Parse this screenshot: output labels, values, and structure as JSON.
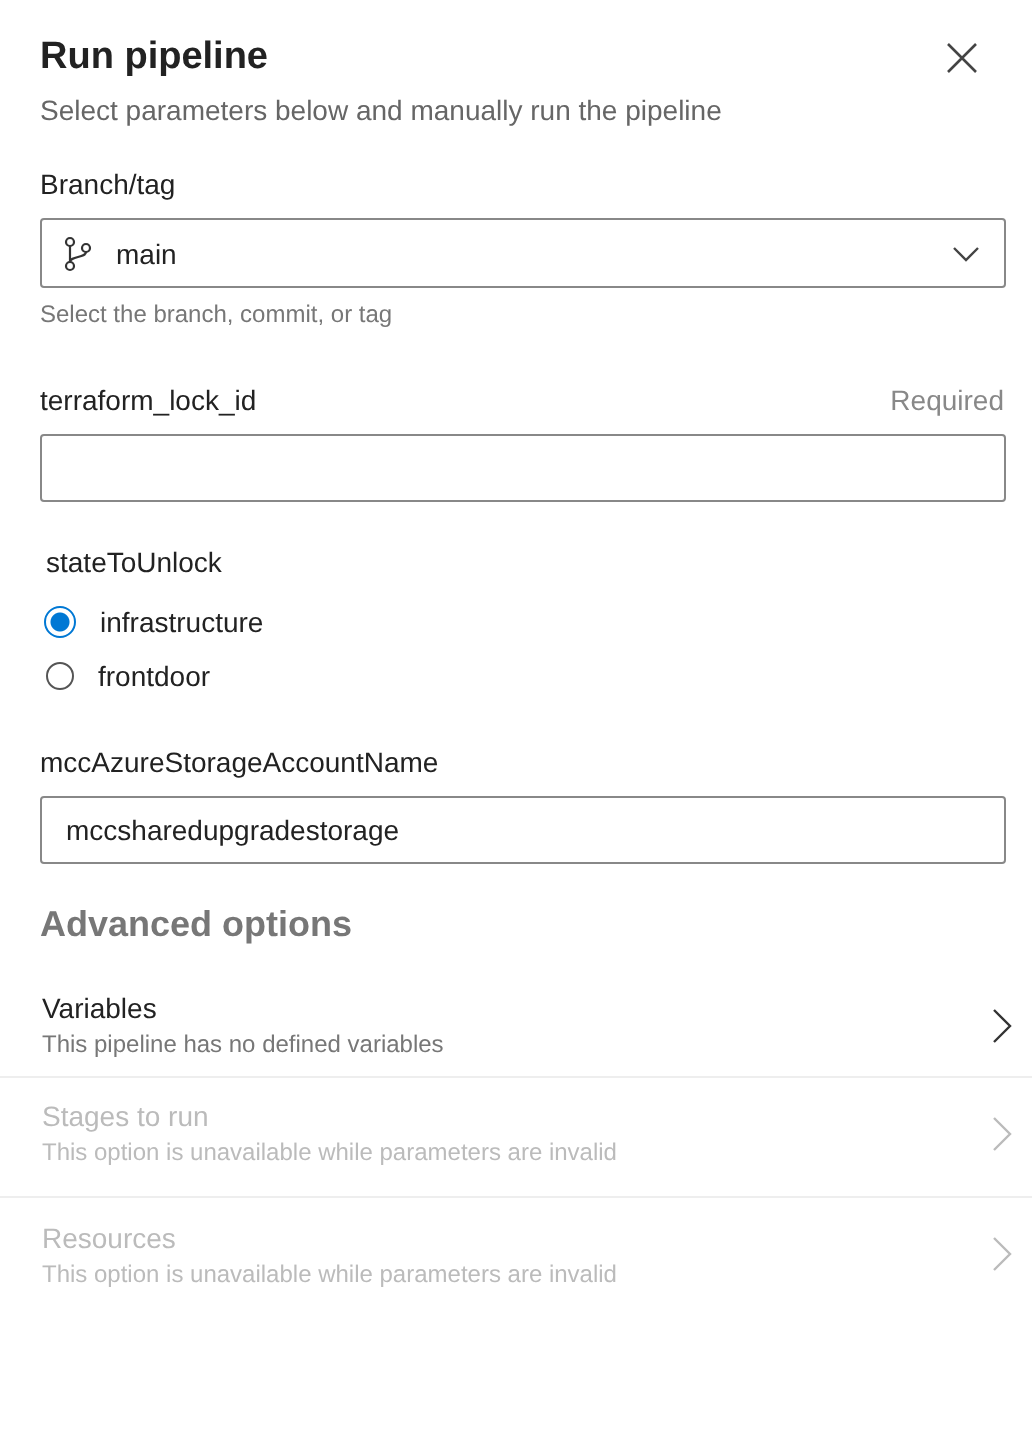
{
  "dialog": {
    "title": "Run pipeline",
    "subtitle": "Select parameters below and manually run the pipeline"
  },
  "branch": {
    "label": "Branch/tag",
    "value": "main",
    "hint": "Select the branch, commit, or tag"
  },
  "parameters": [
    {
      "kind": "text",
      "label": "terraform_lock_id",
      "note": "Required"
    },
    {
      "kind": "radio",
      "label": "stateToUnlock",
      "options": [
        {
          "label": "infrastructure",
          "selected": true
        },
        {
          "label": "frontdoor",
          "selected": false
        }
      ]
    },
    {
      "kind": "text",
      "label": "mccAzureStorageAccountName",
      "value": "mccsharedupgradestorage"
    }
  ],
  "advanced": {
    "title": "Advanced options",
    "items": [
      {
        "title": "Variables",
        "description": "This pipeline has no defined variables",
        "disabled": false
      },
      {
        "title": "Stages to run",
        "description": "This option is unavailable while parameters are invalid",
        "disabled": true
      },
      {
        "title": "Resources",
        "description": "This option is unavailable while parameters are invalid",
        "disabled": true
      }
    ]
  }
}
